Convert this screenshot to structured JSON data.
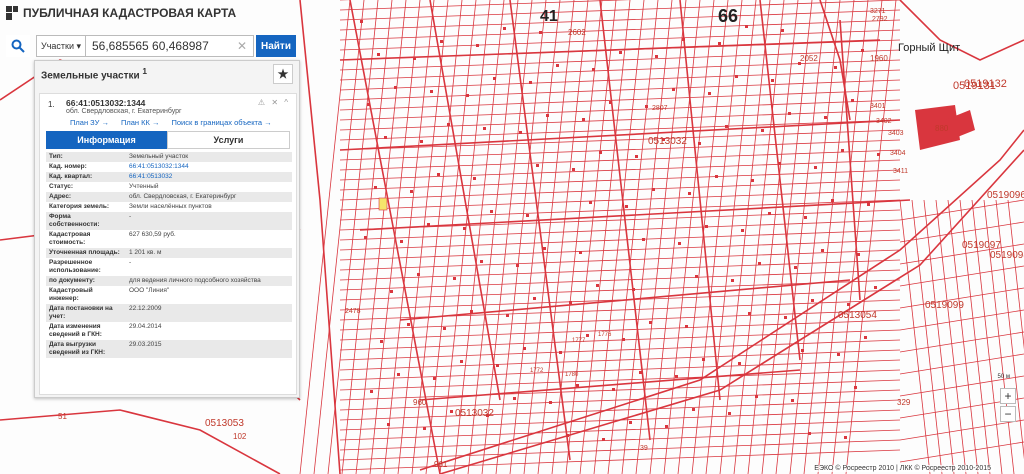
{
  "app": {
    "title": "ПУБЛИЧНАЯ КАДАСТРОВАЯ КАРТА"
  },
  "search": {
    "type": "Участки",
    "value": "56,685565 60,468987",
    "button": "Найти"
  },
  "panel": {
    "title": "Земельные участки",
    "count": "1",
    "item": {
      "number": "1.",
      "cad_number": "66:41:0513032:1344",
      "address": "обл. Свердловская, г. Екатеринбург",
      "links": [
        "План ЗУ →",
        "План КК →",
        "Поиск в границах объекта →"
      ],
      "tabs": [
        "Информация",
        "Услуги"
      ],
      "fields": [
        {
          "k": "Тип:",
          "v": "Земельный участок"
        },
        {
          "k": "Кад. номер:",
          "v": "66:41:0513032:1344"
        },
        {
          "k": "Кад. квартал:",
          "v": "66:41:0513032"
        },
        {
          "k": "Статус:",
          "v": "Учтенный"
        },
        {
          "k": "Адрес:",
          "v": "обл. Свердловская, г. Екатеринбург"
        },
        {
          "k": "Категория земель:",
          "v": "Земли населённых пунктов"
        },
        {
          "k": "Форма собственности:",
          "v": "-"
        },
        {
          "k": "Кадастровая стоимость:",
          "v": "627 630,59 руб."
        },
        {
          "k": "Уточненная площадь:",
          "v": "1 201 кв. м"
        },
        {
          "k": "Разрешенное использование:",
          "v": "-"
        },
        {
          "k": "по документу:",
          "v": "для ведения личного подсобного хозяйства"
        },
        {
          "k": "Кадастровый инженер:",
          "v": "ООО \"Линия\""
        },
        {
          "k": "Дата постановки на учет:",
          "v": "22.12.2009"
        },
        {
          "k": "Дата изменения сведений в ГКН:",
          "v": "29.04.2014"
        },
        {
          "k": "Дата выгрузки сведений из ГКН:",
          "v": "29.03.2015"
        }
      ]
    }
  },
  "map": {
    "labels": [
      "41",
      "66",
      "2602",
      "1960",
      "2052",
      "3271",
      "2792",
      "Горный Щит",
      "0519131",
      "0519132",
      "3401",
      "3402",
      "3403",
      "3404",
      "3411",
      "880",
      "0513032",
      "0513054",
      "0513053",
      "2478",
      "0513032",
      "960",
      "329",
      "961",
      "0519096",
      "0519097",
      "0519098",
      "0519099",
      "39",
      "51",
      "102",
      "2807",
      "1776",
      "1777",
      "1772",
      "1780"
    ],
    "scale": "50 м"
  },
  "zoom": {
    "in": "+",
    "out": "−"
  },
  "attribution": "ЕЭКО © Росреестр 2010 | ЛКК © Росреестр 2010-2015"
}
